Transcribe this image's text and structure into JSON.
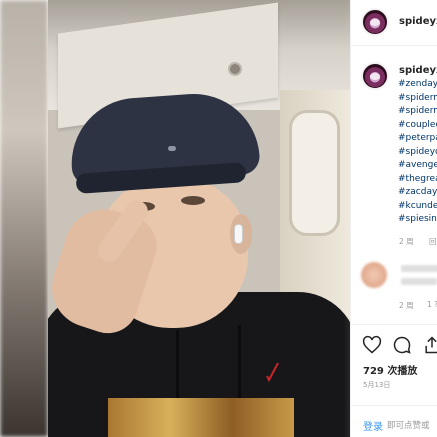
{
  "post": {
    "username": "spideyx",
    "caption_username": "spideyx",
    "hashtags": [
      "#zenday",
      "#spiderm",
      "#spiderm",
      "#couplec",
      "#peterpa",
      "#spideyc",
      "#avenge",
      "#thegrea",
      "#zacday",
      "#kcunde",
      "#spiesin"
    ],
    "caption_time": "2 周",
    "caption_reply": "回",
    "comment_time": "2 周",
    "comment_likes": "1 ?"
  },
  "stats": {
    "plays": "729 次播放",
    "date": "5月13日"
  },
  "footer": {
    "login": "登录",
    "comment_hint": "即可点赞或"
  },
  "icons": [
    "heart-icon",
    "comment-icon",
    "share-icon"
  ]
}
